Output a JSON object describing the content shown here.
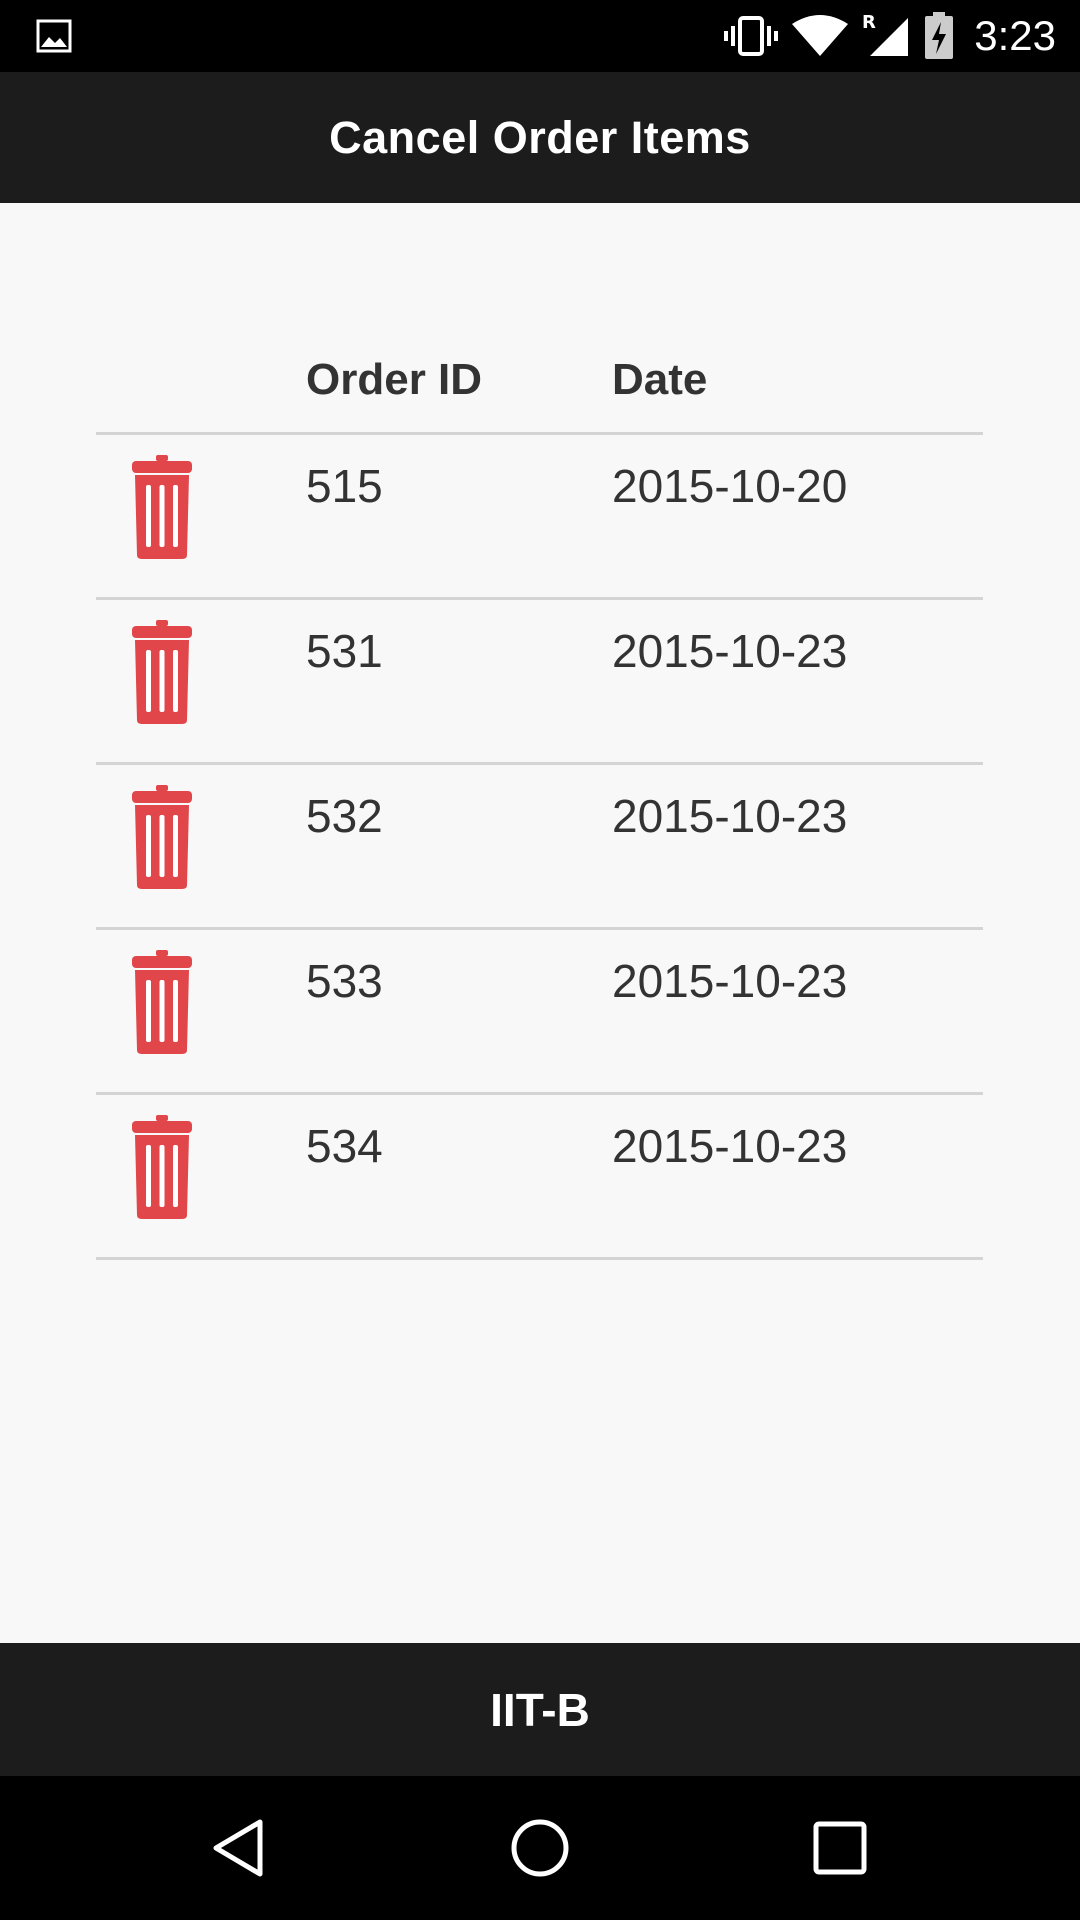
{
  "status_bar": {
    "time": "3:23",
    "icons": [
      "image-icon",
      "vibrate-icon",
      "wifi-icon",
      "signal-roaming-icon",
      "battery-charging-icon"
    ],
    "roaming_indicator": "R"
  },
  "app_bar": {
    "title": "Cancel Order Items"
  },
  "table": {
    "headers": {
      "order_id": "Order ID",
      "date": "Date"
    },
    "rows": [
      {
        "order_id": "515",
        "date": "2015-10-20"
      },
      {
        "order_id": "531",
        "date": "2015-10-23"
      },
      {
        "order_id": "532",
        "date": "2015-10-23"
      },
      {
        "order_id": "533",
        "date": "2015-10-23"
      },
      {
        "order_id": "534",
        "date": "2015-10-23"
      }
    ],
    "row_action_icon": "trash-icon"
  },
  "footer": {
    "label": "IIT-B"
  },
  "nav_bar": {
    "buttons": [
      "back-icon",
      "home-icon",
      "recent-apps-icon"
    ]
  },
  "colors": {
    "app_bar_bg": "#1c1c1c",
    "content_bg": "#f8f8f8",
    "trash_red": "#e0464a",
    "divider": "#d4d4d4",
    "text": "#333333"
  }
}
